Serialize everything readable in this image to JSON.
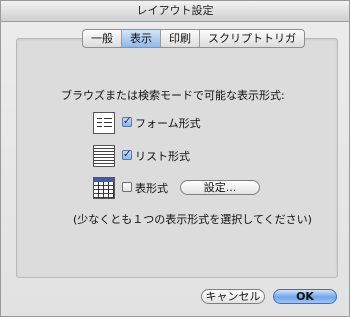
{
  "window": {
    "title": "レイアウト設定"
  },
  "tabs": [
    {
      "label": "一般"
    },
    {
      "label": "表示",
      "active": true
    },
    {
      "label": "印刷"
    },
    {
      "label": "スクリプトトリガ"
    }
  ],
  "display": {
    "prompt": "ブラウズまたは検索モードで可能な表示形式:",
    "options": [
      {
        "label": "フォーム形式",
        "checked": true,
        "icon": "form-view-icon"
      },
      {
        "label": "リスト形式",
        "checked": true,
        "icon": "list-view-icon"
      },
      {
        "label": "表形式",
        "checked": false,
        "icon": "table-view-icon"
      }
    ],
    "settings_button": "設定...",
    "note": "(少なくとも１つの表示形式を選択してください)"
  },
  "footer": {
    "cancel_label": "キャンセル",
    "ok_label": "OK"
  },
  "colors": {
    "accent": "#6ea6ec"
  }
}
